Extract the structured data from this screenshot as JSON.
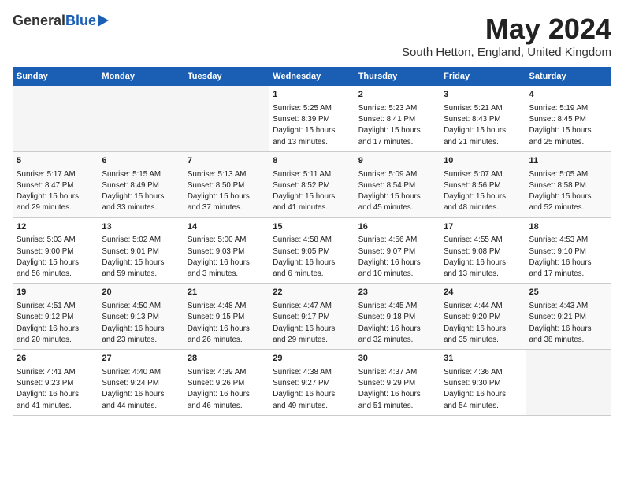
{
  "logo": {
    "general": "General",
    "blue": "Blue"
  },
  "title": "May 2024",
  "location": "South Hetton, England, United Kingdom",
  "days_of_week": [
    "Sunday",
    "Monday",
    "Tuesday",
    "Wednesday",
    "Thursday",
    "Friday",
    "Saturday"
  ],
  "weeks": [
    [
      {
        "day": "",
        "empty": true
      },
      {
        "day": "",
        "empty": true
      },
      {
        "day": "",
        "empty": true
      },
      {
        "day": "1",
        "lines": [
          "Sunrise: 5:25 AM",
          "Sunset: 8:39 PM",
          "Daylight: 15 hours",
          "and 13 minutes."
        ]
      },
      {
        "day": "2",
        "lines": [
          "Sunrise: 5:23 AM",
          "Sunset: 8:41 PM",
          "Daylight: 15 hours",
          "and 17 minutes."
        ]
      },
      {
        "day": "3",
        "lines": [
          "Sunrise: 5:21 AM",
          "Sunset: 8:43 PM",
          "Daylight: 15 hours",
          "and 21 minutes."
        ]
      },
      {
        "day": "4",
        "lines": [
          "Sunrise: 5:19 AM",
          "Sunset: 8:45 PM",
          "Daylight: 15 hours",
          "and 25 minutes."
        ]
      }
    ],
    [
      {
        "day": "5",
        "lines": [
          "Sunrise: 5:17 AM",
          "Sunset: 8:47 PM",
          "Daylight: 15 hours",
          "and 29 minutes."
        ]
      },
      {
        "day": "6",
        "lines": [
          "Sunrise: 5:15 AM",
          "Sunset: 8:49 PM",
          "Daylight: 15 hours",
          "and 33 minutes."
        ]
      },
      {
        "day": "7",
        "lines": [
          "Sunrise: 5:13 AM",
          "Sunset: 8:50 PM",
          "Daylight: 15 hours",
          "and 37 minutes."
        ]
      },
      {
        "day": "8",
        "lines": [
          "Sunrise: 5:11 AM",
          "Sunset: 8:52 PM",
          "Daylight: 15 hours",
          "and 41 minutes."
        ]
      },
      {
        "day": "9",
        "lines": [
          "Sunrise: 5:09 AM",
          "Sunset: 8:54 PM",
          "Daylight: 15 hours",
          "and 45 minutes."
        ]
      },
      {
        "day": "10",
        "lines": [
          "Sunrise: 5:07 AM",
          "Sunset: 8:56 PM",
          "Daylight: 15 hours",
          "and 48 minutes."
        ]
      },
      {
        "day": "11",
        "lines": [
          "Sunrise: 5:05 AM",
          "Sunset: 8:58 PM",
          "Daylight: 15 hours",
          "and 52 minutes."
        ]
      }
    ],
    [
      {
        "day": "12",
        "lines": [
          "Sunrise: 5:03 AM",
          "Sunset: 9:00 PM",
          "Daylight: 15 hours",
          "and 56 minutes."
        ]
      },
      {
        "day": "13",
        "lines": [
          "Sunrise: 5:02 AM",
          "Sunset: 9:01 PM",
          "Daylight: 15 hours",
          "and 59 minutes."
        ]
      },
      {
        "day": "14",
        "lines": [
          "Sunrise: 5:00 AM",
          "Sunset: 9:03 PM",
          "Daylight: 16 hours",
          "and 3 minutes."
        ]
      },
      {
        "day": "15",
        "lines": [
          "Sunrise: 4:58 AM",
          "Sunset: 9:05 PM",
          "Daylight: 16 hours",
          "and 6 minutes."
        ]
      },
      {
        "day": "16",
        "lines": [
          "Sunrise: 4:56 AM",
          "Sunset: 9:07 PM",
          "Daylight: 16 hours",
          "and 10 minutes."
        ]
      },
      {
        "day": "17",
        "lines": [
          "Sunrise: 4:55 AM",
          "Sunset: 9:08 PM",
          "Daylight: 16 hours",
          "and 13 minutes."
        ]
      },
      {
        "day": "18",
        "lines": [
          "Sunrise: 4:53 AM",
          "Sunset: 9:10 PM",
          "Daylight: 16 hours",
          "and 17 minutes."
        ]
      }
    ],
    [
      {
        "day": "19",
        "lines": [
          "Sunrise: 4:51 AM",
          "Sunset: 9:12 PM",
          "Daylight: 16 hours",
          "and 20 minutes."
        ]
      },
      {
        "day": "20",
        "lines": [
          "Sunrise: 4:50 AM",
          "Sunset: 9:13 PM",
          "Daylight: 16 hours",
          "and 23 minutes."
        ]
      },
      {
        "day": "21",
        "lines": [
          "Sunrise: 4:48 AM",
          "Sunset: 9:15 PM",
          "Daylight: 16 hours",
          "and 26 minutes."
        ]
      },
      {
        "day": "22",
        "lines": [
          "Sunrise: 4:47 AM",
          "Sunset: 9:17 PM",
          "Daylight: 16 hours",
          "and 29 minutes."
        ]
      },
      {
        "day": "23",
        "lines": [
          "Sunrise: 4:45 AM",
          "Sunset: 9:18 PM",
          "Daylight: 16 hours",
          "and 32 minutes."
        ]
      },
      {
        "day": "24",
        "lines": [
          "Sunrise: 4:44 AM",
          "Sunset: 9:20 PM",
          "Daylight: 16 hours",
          "and 35 minutes."
        ]
      },
      {
        "day": "25",
        "lines": [
          "Sunrise: 4:43 AM",
          "Sunset: 9:21 PM",
          "Daylight: 16 hours",
          "and 38 minutes."
        ]
      }
    ],
    [
      {
        "day": "26",
        "lines": [
          "Sunrise: 4:41 AM",
          "Sunset: 9:23 PM",
          "Daylight: 16 hours",
          "and 41 minutes."
        ]
      },
      {
        "day": "27",
        "lines": [
          "Sunrise: 4:40 AM",
          "Sunset: 9:24 PM",
          "Daylight: 16 hours",
          "and 44 minutes."
        ]
      },
      {
        "day": "28",
        "lines": [
          "Sunrise: 4:39 AM",
          "Sunset: 9:26 PM",
          "Daylight: 16 hours",
          "and 46 minutes."
        ]
      },
      {
        "day": "29",
        "lines": [
          "Sunrise: 4:38 AM",
          "Sunset: 9:27 PM",
          "Daylight: 16 hours",
          "and 49 minutes."
        ]
      },
      {
        "day": "30",
        "lines": [
          "Sunrise: 4:37 AM",
          "Sunset: 9:29 PM",
          "Daylight: 16 hours",
          "and 51 minutes."
        ]
      },
      {
        "day": "31",
        "lines": [
          "Sunrise: 4:36 AM",
          "Sunset: 9:30 PM",
          "Daylight: 16 hours",
          "and 54 minutes."
        ]
      },
      {
        "day": "",
        "empty": true
      }
    ]
  ]
}
